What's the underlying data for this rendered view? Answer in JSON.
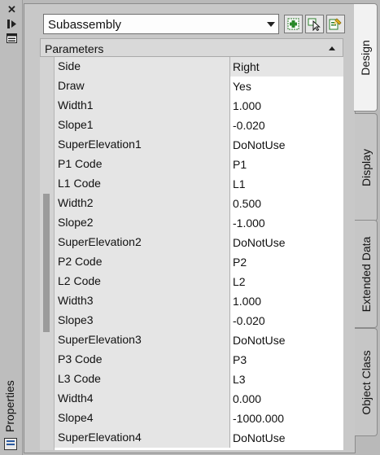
{
  "window": {
    "title": "Properties",
    "icons": [
      "close-icon",
      "auto-hide-icon",
      "properties-menu-icon"
    ]
  },
  "toolbar": {
    "object_type": "Subassembly",
    "buttons": [
      "add-to-selection-icon",
      "quick-select-icon",
      "toggle-pickadd-icon"
    ]
  },
  "parameters": {
    "header": "Parameters",
    "rows": [
      {
        "name": "Side",
        "value": "Right"
      },
      {
        "name": "Draw",
        "value": "Yes"
      },
      {
        "name": "Width1",
        "value": "1.000"
      },
      {
        "name": "Slope1",
        "value": "-0.020"
      },
      {
        "name": "SuperElevation1",
        "value": "DoNotUse"
      },
      {
        "name": "P1 Code",
        "value": "P1"
      },
      {
        "name": "L1 Code",
        "value": "L1"
      },
      {
        "name": "Width2",
        "value": "0.500"
      },
      {
        "name": "Slope2",
        "value": "-1.000"
      },
      {
        "name": "SuperElevation2",
        "value": "DoNotUse"
      },
      {
        "name": "P2 Code",
        "value": "P2"
      },
      {
        "name": "L2 Code",
        "value": "L2"
      },
      {
        "name": "Width3",
        "value": "1.000"
      },
      {
        "name": "Slope3",
        "value": "-0.020"
      },
      {
        "name": "SuperElevation3",
        "value": "DoNotUse"
      },
      {
        "name": "P3 Code",
        "value": "P3"
      },
      {
        "name": "L3 Code",
        "value": "L3"
      },
      {
        "name": "Width4",
        "value": "0.000"
      },
      {
        "name": "Slope4",
        "value": "-1000.000"
      },
      {
        "name": "SuperElevation4",
        "value": "DoNotUse"
      }
    ]
  },
  "tabs": [
    {
      "label": "Design",
      "active": true
    },
    {
      "label": "Display",
      "active": false
    },
    {
      "label": "Extended Data",
      "active": false
    },
    {
      "label": "Object Class",
      "active": false
    }
  ],
  "colors": {
    "panel_bg": "#c8c8c8",
    "name_cell_bg": "#e5e5e5",
    "value_cell_bg": "#ffffff"
  }
}
